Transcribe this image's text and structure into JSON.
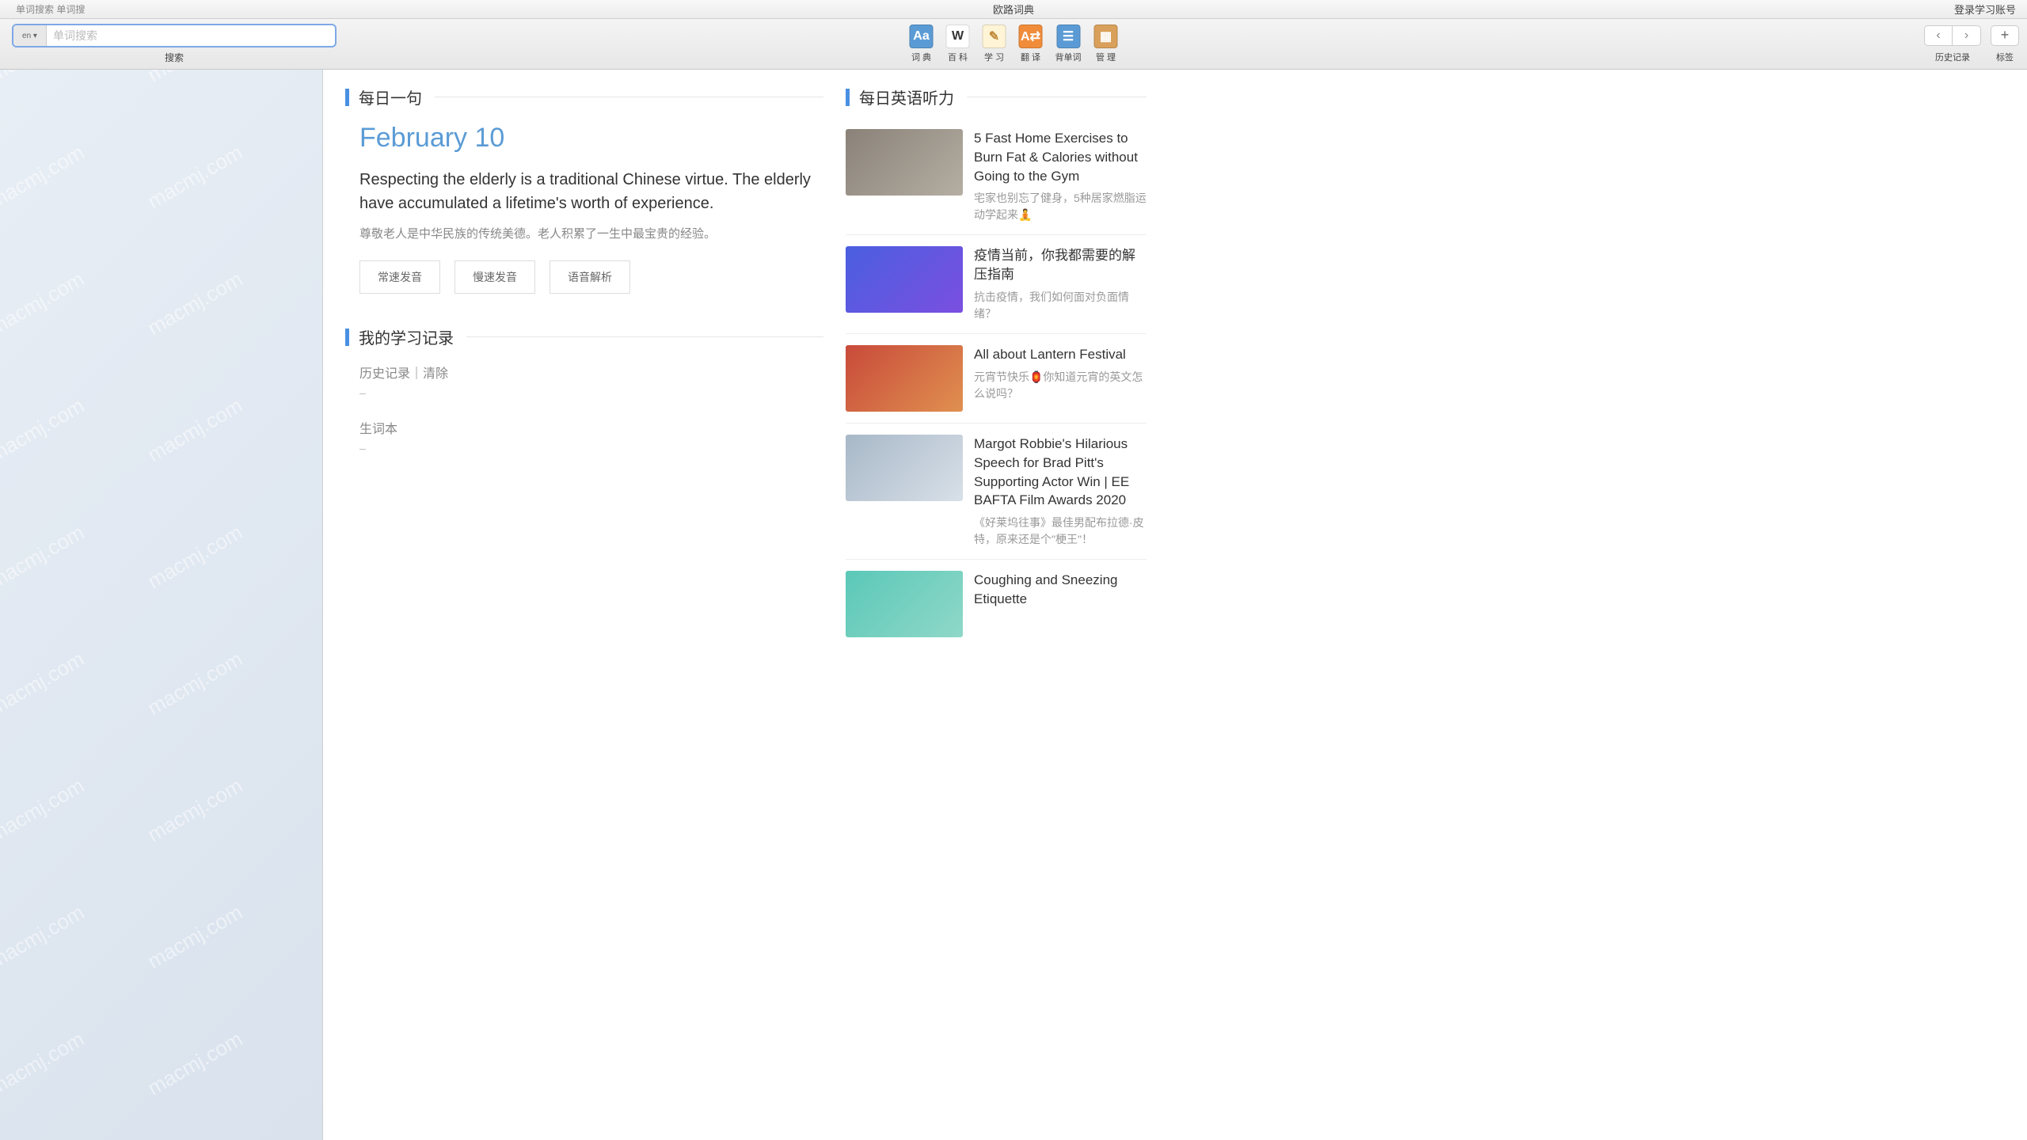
{
  "titlebar": {
    "hint": "单词搜索 单词搜",
    "title": "欧路词典",
    "login": "登录学习账号"
  },
  "search": {
    "prefix": "en ▾",
    "placeholder": "单词搜索",
    "label": "搜索"
  },
  "tools": [
    {
      "label": "词 典",
      "bg": "#5b9bd5",
      "fg": "#fff",
      "glyph": "Aa"
    },
    {
      "label": "百 科",
      "bg": "#fff",
      "fg": "#333",
      "glyph": "W"
    },
    {
      "label": "学 习",
      "bg": "#fff4d6",
      "fg": "#c08b3a",
      "glyph": "✎"
    },
    {
      "label": "翻 译",
      "bg": "#f08c3a",
      "fg": "#fff",
      "glyph": "A⇄"
    },
    {
      "label": "背单词",
      "bg": "#5b9bd5",
      "fg": "#fff",
      "glyph": "☰"
    },
    {
      "label": "管 理",
      "bg": "#d9a05b",
      "fg": "#fff",
      "glyph": "▦"
    }
  ],
  "right_tools": {
    "history": "历史记录",
    "bookmark": "标签"
  },
  "daily": {
    "header": "每日一句",
    "date": "February 10",
    "en": "Respecting the elderly is a traditional Chinese virtue. The elderly have accumulated a lifetime's worth of experience.",
    "cn": "尊敬老人是中华民族的传统美德。老人积累了一生中最宝贵的经验。",
    "btn_normal": "常速发音",
    "btn_slow": "慢速发音",
    "btn_parse": "语音解析"
  },
  "study": {
    "header": "我的学习记录",
    "history_label": "历史记录｜清除",
    "vocab_label": "生词本",
    "dash": "–"
  },
  "listening": {
    "header": "每日英语听力",
    "items": [
      {
        "title": "5 Fast Home Exercises to Burn Fat & Calories without Going to the Gym",
        "sub": "宅家也别忘了健身，5种居家燃脂运动学起来🧘",
        "bg": "linear-gradient(135deg,#8a8278,#b5aea3)"
      },
      {
        "title": "疫情当前，你我都需要的解压指南",
        "sub": "抗击疫情，我们如何面对负面情绪？",
        "bg": "linear-gradient(135deg,#4a5fe0,#7b4fe0)"
      },
      {
        "title": "All about Lantern Festival",
        "sub": "元宵节快乐🏮你知道元宵的英文怎么说吗？",
        "bg": "linear-gradient(135deg,#c84a3a,#e09050)"
      },
      {
        "title": "Margot Robbie's Hilarious Speech for Brad Pitt's Supporting Actor Win | EE BAFTA Film Awards 2020",
        "sub": "《好莱坞往事》最佳男配布拉德·皮特，原来还是个\"梗王\"！",
        "bg": "linear-gradient(135deg,#a8b8c8,#d8e0e8)"
      },
      {
        "title": "Coughing and Sneezing Etiquette",
        "sub": "",
        "bg": "linear-gradient(135deg,#5bc8b8,#8fd8c8)"
      }
    ]
  }
}
